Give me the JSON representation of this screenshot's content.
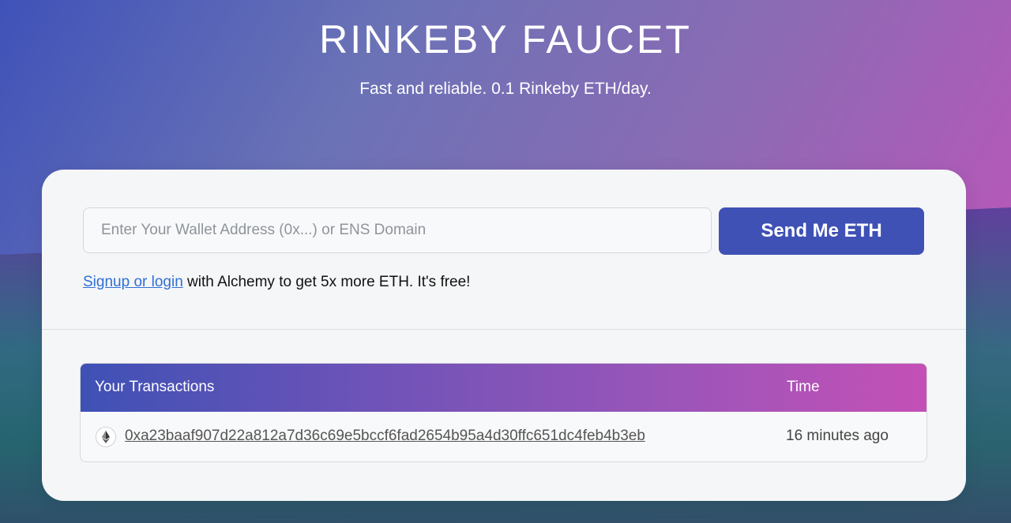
{
  "hero": {
    "title": "RINKEBY FAUCET",
    "subtitle": "Fast and reliable. 0.1 Rinkeby ETH/day."
  },
  "form": {
    "address_placeholder": "Enter Your Wallet Address (0x...) or ENS Domain",
    "address_value": "",
    "send_label": "Send Me ETH"
  },
  "promo": {
    "link_label": "Signup or login",
    "text": " with Alchemy to get 5x more ETH. It's free!"
  },
  "transactions": {
    "header_tx": "Your Transactions",
    "header_time": "Time",
    "rows": [
      {
        "icon": "ethereum-icon",
        "hash": "0xa23baaf907d22a812a7d36c69e5bccf6fad2654b95a4d30ffc651dc4feb4b3eb",
        "time": "16 minutes ago"
      }
    ]
  },
  "colors": {
    "accent": "#3f51b5",
    "gradient_end": "#c450b6",
    "link": "#2f6fd6"
  }
}
